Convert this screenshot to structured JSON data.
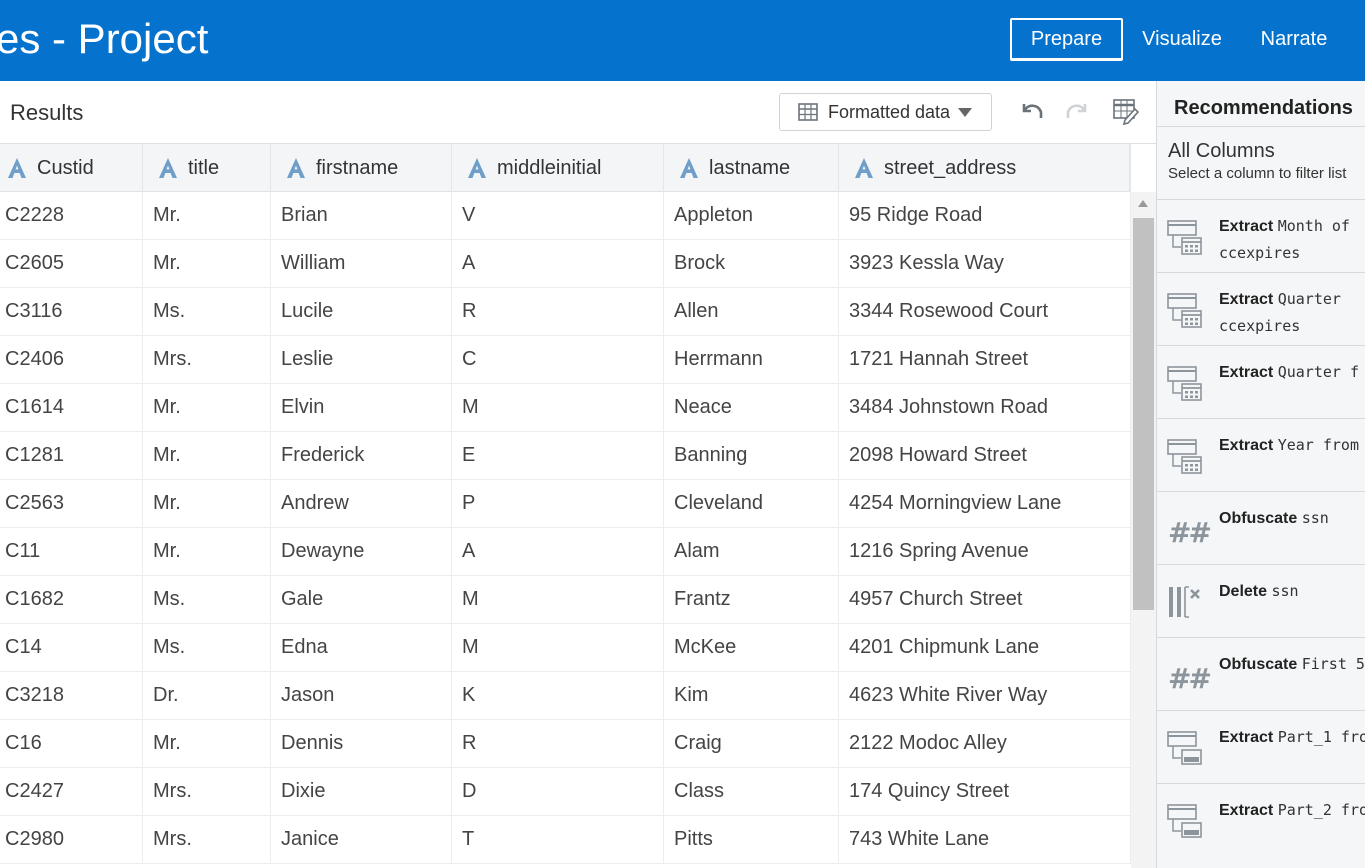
{
  "header": {
    "title": "es - Project",
    "nav": [
      {
        "label": "Prepare",
        "active": true
      },
      {
        "label": "Visualize",
        "active": false
      },
      {
        "label": "Narrate",
        "active": false
      }
    ]
  },
  "results": {
    "label": "Results",
    "format_dropdown": "Formatted data"
  },
  "table": {
    "columns": [
      "Custid",
      "title",
      "firstname",
      "middleinitial",
      "lastname",
      "street_address"
    ],
    "rows": [
      [
        "C2228",
        "Mr.",
        "Brian",
        "V",
        "Appleton",
        "95 Ridge Road"
      ],
      [
        "C2605",
        "Mr.",
        "William",
        "A",
        "Brock",
        "3923 Kessla Way"
      ],
      [
        "C3116",
        "Ms.",
        "Lucile",
        "R",
        "Allen",
        "3344 Rosewood Court"
      ],
      [
        "C2406",
        "Mrs.",
        "Leslie",
        "C",
        "Herrmann",
        "1721 Hannah Street"
      ],
      [
        "C1614",
        "Mr.",
        "Elvin",
        "M",
        "Neace",
        "3484 Johnstown Road"
      ],
      [
        "C1281",
        "Mr.",
        "Frederick",
        "E",
        "Banning",
        "2098 Howard Street"
      ],
      [
        "C2563",
        "Mr.",
        "Andrew",
        "P",
        "Cleveland",
        "4254 Morningview Lane"
      ],
      [
        "C11",
        "Mr.",
        "Dewayne",
        "A",
        "Alam",
        "1216 Spring Avenue"
      ],
      [
        "C1682",
        "Ms.",
        "Gale",
        "M",
        "Frantz",
        "4957 Church Street"
      ],
      [
        "C14",
        "Ms.",
        "Edna",
        "M",
        "McKee",
        "4201 Chipmunk Lane"
      ],
      [
        "C3218",
        "Dr.",
        "Jason",
        "K",
        "Kim",
        "4623 White River Way"
      ],
      [
        "C16",
        "Mr.",
        "Dennis",
        "R",
        "Craig",
        "2122 Modoc Alley"
      ],
      [
        "C2427",
        "Mrs.",
        "Dixie",
        "D",
        "Class",
        "174 Quincy Street"
      ],
      [
        "C2980",
        "Mrs.",
        "Janice",
        "T",
        "Pitts",
        "743 White Lane"
      ]
    ]
  },
  "recommendations": {
    "title": "Recommendations",
    "all_columns": "All Columns",
    "hint": "Select a column to filter list",
    "items": [
      {
        "action": "Extract",
        "line1": "Month of",
        "line2": "ccexpires",
        "icon": "extract-date-icon"
      },
      {
        "action": "Extract",
        "line1": "Quarter",
        "line2": "ccexpires",
        "icon": "extract-date-icon"
      },
      {
        "action": "Extract",
        "line1": "Quarter f",
        "line2": "",
        "icon": "extract-date-icon"
      },
      {
        "action": "Extract",
        "line1": "Year from",
        "line2": "",
        "icon": "extract-date-icon"
      },
      {
        "action": "Obfuscate",
        "line1": "ssn",
        "line2": "",
        "icon": "hash-icon"
      },
      {
        "action": "Delete",
        "line1": "ssn",
        "line2": "",
        "icon": "delete-column-icon"
      },
      {
        "action": "Obfuscate",
        "line1": "First 5",
        "line2": "",
        "icon": "hash-icon"
      },
      {
        "action": "Extract",
        "line1": "Part_1 fro",
        "line2": "",
        "icon": "extract-part-icon"
      },
      {
        "action": "Extract",
        "line1": "Part_2 fro",
        "line2": "",
        "icon": "extract-part-icon"
      }
    ]
  },
  "colors": {
    "header_bg": "#0572ce",
    "attribute_icon": "#6f9fc9",
    "icon_gray": "#8d959c"
  }
}
